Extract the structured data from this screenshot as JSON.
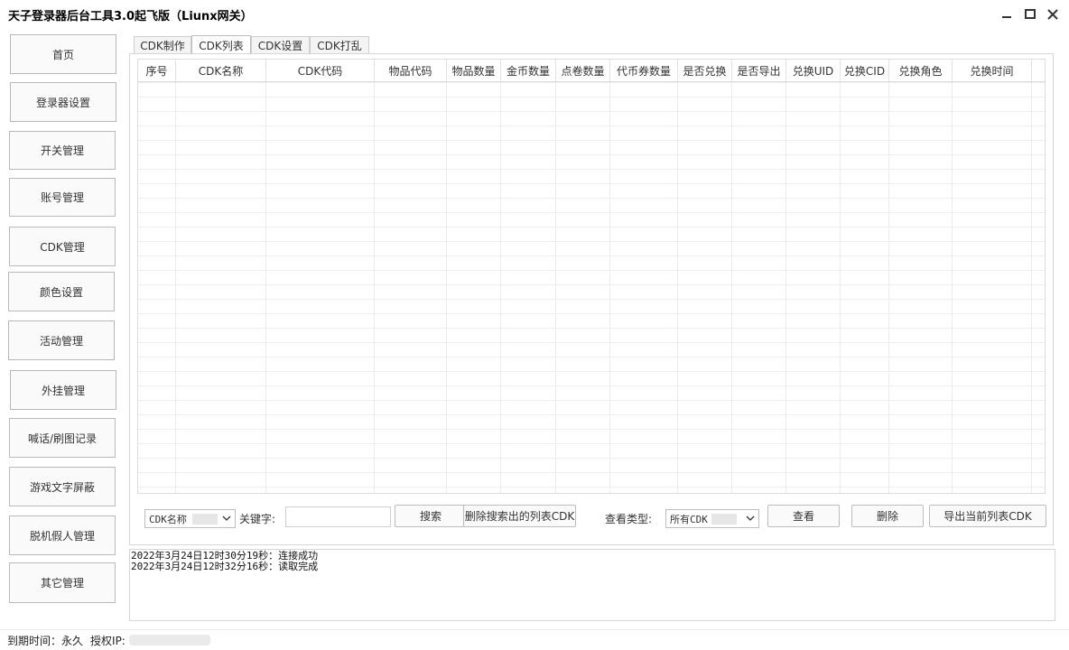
{
  "window": {
    "title": "天子登录器后台工具3.0起飞版（Liunx网关）",
    "controls": [
      "minimize-icon",
      "maximize-icon",
      "close-icon"
    ]
  },
  "sidebar": {
    "items": [
      {
        "label": "首页"
      },
      {
        "label": "登录器设置"
      },
      {
        "label": "开关管理"
      },
      {
        "label": "账号管理"
      },
      {
        "label": "CDK管理"
      },
      {
        "label": "颜色设置"
      },
      {
        "label": "活动管理"
      },
      {
        "label": "外挂管理"
      },
      {
        "label": "喊话/刷图记录"
      },
      {
        "label": "游戏文字屏蔽"
      },
      {
        "label": "脱机假人管理"
      },
      {
        "label": "其它管理"
      }
    ]
  },
  "tabs": [
    {
      "label": "CDK制作"
    },
    {
      "label": "CDK列表",
      "active": true
    },
    {
      "label": "CDK设置"
    },
    {
      "label": "CDK打乱"
    }
  ],
  "table": {
    "columns": [
      "序号",
      "CDK名称",
      "CDK代码",
      "物品代码",
      "物品数量",
      "金币数量",
      "点卷数量",
      "代币券数量",
      "是否兑换",
      "是否导出",
      "兑换UID",
      "兑换CID",
      "兑换角色",
      "兑换时间"
    ],
    "rows": []
  },
  "search": {
    "field_select": "CDK名称",
    "keyword_label": "关键字:",
    "keyword_value": "",
    "search_button": "搜索",
    "delete_search_button": "删除搜索出的列表CDK",
    "view_type_label": "查看类型:",
    "view_type_select": "所有CDK",
    "view_button": "查看",
    "delete_button": "删除",
    "export_button": "导出当前列表CDK"
  },
  "log": {
    "lines": [
      "2022年3月24日12时30分19秒：连接成功",
      "2022年3月24日12时32分16秒：读取完成"
    ]
  },
  "status": {
    "expiry_label": "到期时间：",
    "expiry_value": "永久",
    "ip_label": "授权IP:"
  }
}
